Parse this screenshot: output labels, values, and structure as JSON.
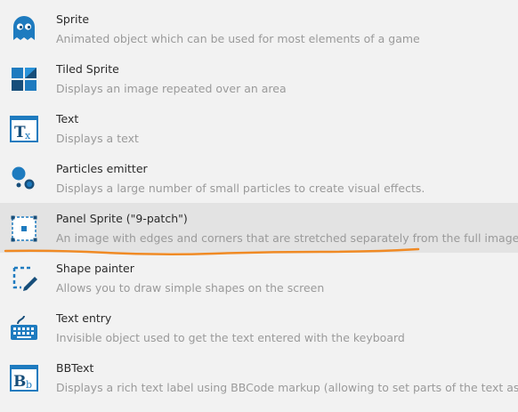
{
  "objects": [
    {
      "title": "Sprite",
      "description": "Animated object which can be used for most elements of a game",
      "icon": "ghost-icon"
    },
    {
      "title": "Tiled Sprite",
      "description": "Displays an image repeated over an area",
      "icon": "tiles-icon"
    },
    {
      "title": "Text",
      "description": "Displays a text",
      "icon": "text-icon"
    },
    {
      "title": "Particles emitter",
      "description": "Displays a large number of small particles to create visual effects.",
      "icon": "particles-icon"
    },
    {
      "title": "Panel Sprite (\"9-patch\")",
      "description": "An image with edges and corners that are stretched separately from the full image.",
      "icon": "panel-sprite-icon"
    },
    {
      "title": "Shape painter",
      "description": "Allows you to draw simple shapes on the screen",
      "icon": "shape-painter-icon"
    },
    {
      "title": "Text entry",
      "description": "Invisible object used to get the text entered with the keyboard",
      "icon": "keyboard-icon"
    },
    {
      "title": "BBText",
      "description": "Displays a rich text label using BBCode markup (allowing to set parts of the text as b",
      "icon": "bbtext-icon"
    }
  ],
  "colors": {
    "icon_primary": "#1e7bbf",
    "icon_dark": "#174e7a",
    "highlight_underline": "#f08a24",
    "selected_background": "#e3e3e3"
  }
}
